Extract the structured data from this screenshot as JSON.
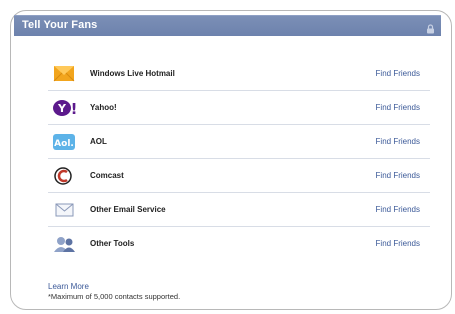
{
  "panel": {
    "title": "Tell Your Fans",
    "lock_icon": "lock-icon"
  },
  "services": [
    {
      "name": "Windows Live Hotmail",
      "icon": "hotmail-envelope-icon",
      "action": "Find Friends"
    },
    {
      "name": "Yahoo!",
      "icon": "yahoo-logo-icon",
      "action": "Find Friends"
    },
    {
      "name": "AOL",
      "icon": "aol-logo-icon",
      "action": "Find Friends"
    },
    {
      "name": "Comcast",
      "icon": "comcast-logo-icon",
      "action": "Find Friends"
    },
    {
      "name": "Other Email Service",
      "icon": "envelope-icon",
      "action": "Find Friends"
    },
    {
      "name": "Other Tools",
      "icon": "people-icon",
      "action": "Find Friends"
    }
  ],
  "footer": {
    "learn_more": "Learn More",
    "note": "*Maximum of 5,000 contacts supported."
  },
  "colors": {
    "header": "#6d82ad",
    "link": "#3b5998",
    "yahoo": "#6a1b9a",
    "aol": "#4aa3df",
    "hotmail": "#f0a020"
  },
  "yahoo_logo_text": "Y!"
}
